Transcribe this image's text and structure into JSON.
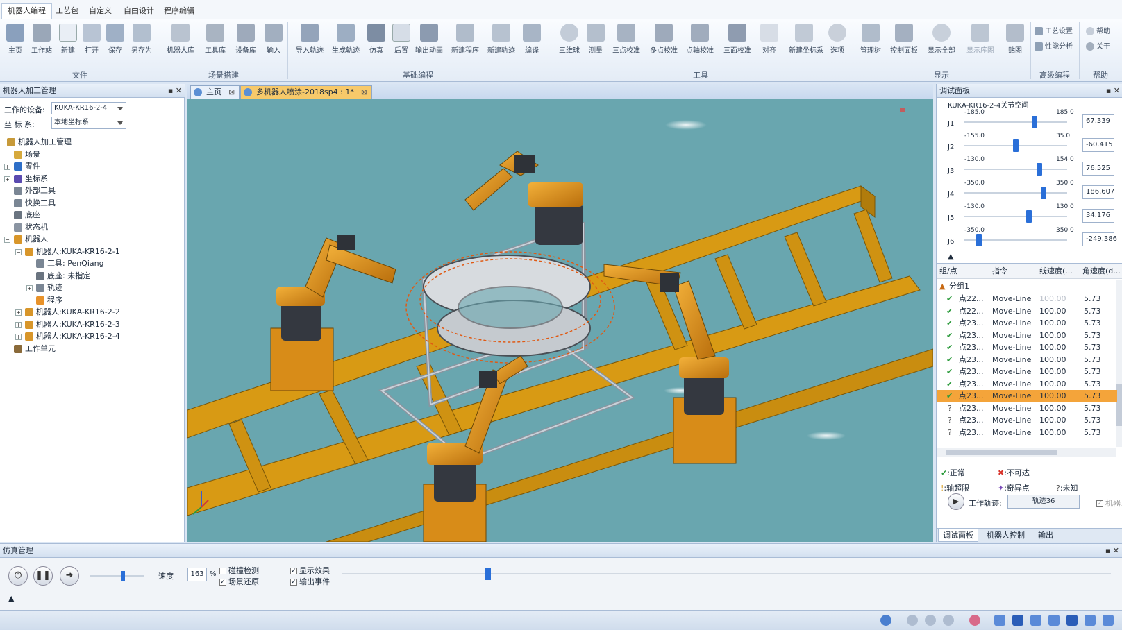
{
  "ribbon": {
    "tabs": [
      {
        "label": "机器人编程"
      },
      {
        "label": "工艺包"
      },
      {
        "label": "自定义"
      },
      {
        "label": "自由设计"
      },
      {
        "label": "程序编辑"
      }
    ],
    "file_buttons": [
      {
        "label": "主页"
      },
      {
        "label": "工作站"
      },
      {
        "label": "新建"
      },
      {
        "label": "打开"
      },
      {
        "label": "保存"
      },
      {
        "label": "另存为"
      }
    ],
    "scene_buttons": [
      {
        "label": "机器人库"
      },
      {
        "label": "工具库"
      },
      {
        "label": "设备库"
      },
      {
        "label": "输入"
      }
    ],
    "basic_buttons": [
      {
        "label": "导入轨迹"
      },
      {
        "label": "生成轨迹"
      },
      {
        "label": "仿真"
      },
      {
        "label": "后置"
      },
      {
        "label": "输出动画"
      },
      {
        "label": "新建程序"
      },
      {
        "label": "新建轨迹"
      },
      {
        "label": "编译"
      }
    ],
    "tool_buttons": [
      {
        "label": "三维球"
      },
      {
        "label": "测量"
      },
      {
        "label": "三点校准"
      },
      {
        "label": "多点校准"
      },
      {
        "label": "点轴校准"
      },
      {
        "label": "三面校准"
      },
      {
        "label": "对齐"
      },
      {
        "label": "新建坐标系"
      },
      {
        "label": "选项"
      }
    ],
    "display_buttons": [
      {
        "label": "管理树"
      },
      {
        "label": "控制面板"
      },
      {
        "label": "显示全部"
      },
      {
        "label": "显示序图"
      },
      {
        "label": "贴图"
      }
    ],
    "advanced": {
      "label1": "工艺设置",
      "label2": "性能分析"
    },
    "help": {
      "label1": "帮助",
      "label2": "关于"
    },
    "groups": {
      "file": "文件",
      "scene": "场景搭建",
      "basic": "基础编程",
      "tools": "工具",
      "display": "显示",
      "advanced": "高级编程",
      "help": "帮助"
    }
  },
  "left_panel": {
    "title": "机器人加工管理",
    "device_label": "工作的设备:",
    "device_value": "KUKA-KR16-2-4",
    "coord_label": "坐  标  系:",
    "coord_value": "本地坐标系",
    "tree": [
      {
        "label": "机器人加工管理"
      },
      {
        "label": "场景"
      },
      {
        "label": "零件"
      },
      {
        "label": "坐标系"
      },
      {
        "label": "外部工具"
      },
      {
        "label": "快换工具"
      },
      {
        "label": "底座"
      },
      {
        "label": "状态机"
      },
      {
        "label": "机器人"
      },
      {
        "label": "机器人:KUKA-KR16-2-1"
      },
      {
        "label": "工具: PenQiang"
      },
      {
        "label": "底座: 未指定"
      },
      {
        "label": "轨迹"
      },
      {
        "label": "程序"
      },
      {
        "label": "机器人:KUKA-KR16-2-2"
      },
      {
        "label": "机器人:KUKA-KR16-2-3"
      },
      {
        "label": "机器人:KUKA-KR16-2-4"
      },
      {
        "label": "工作单元"
      }
    ]
  },
  "doc_tabs": [
    {
      "label": "主页"
    },
    {
      "label": "多机器人喷涂-2018sp4 : 1*"
    }
  ],
  "debug_panel": {
    "title": "调试面板",
    "joint_space_title": "KUKA-KR16-2-4关节空间",
    "joints": [
      {
        "name": "J1",
        "min": "-185.0",
        "max": "185.0",
        "value": "67.339",
        "pos": 0.68
      },
      {
        "name": "J2",
        "min": "-155.0",
        "max": "35.0",
        "value": "-60.415",
        "pos": 0.5
      },
      {
        "name": "J3",
        "min": "-130.0",
        "max": "154.0",
        "value": "76.525",
        "pos": 0.73
      },
      {
        "name": "J4",
        "min": "-350.0",
        "max": "350.0",
        "value": "186.607",
        "pos": 0.77
      },
      {
        "name": "J5",
        "min": "-130.0",
        "max": "130.0",
        "value": "34.176",
        "pos": 0.63
      },
      {
        "name": "J6",
        "min": "-350.0",
        "max": "350.0",
        "value": "-249.386",
        "pos": 0.14
      }
    ],
    "table_headers": {
      "point": "组/点",
      "command": "指令",
      "linear": "线速度(...",
      "angular": "角速度(d..."
    },
    "group_label": "分组1",
    "rows": [
      {
        "status": "ok",
        "name": "点22...",
        "cmd": "Move-Line",
        "lin": "100.00",
        "ang": "5.73",
        "faded": true
      },
      {
        "status": "ok",
        "name": "点22...",
        "cmd": "Move-Line",
        "lin": "100.00",
        "ang": "5.73"
      },
      {
        "status": "ok",
        "name": "点23...",
        "cmd": "Move-Line",
        "lin": "100.00",
        "ang": "5.73"
      },
      {
        "status": "ok",
        "name": "点23...",
        "cmd": "Move-Line",
        "lin": "100.00",
        "ang": "5.73"
      },
      {
        "status": "ok",
        "name": "点23...",
        "cmd": "Move-Line",
        "lin": "100.00",
        "ang": "5.73"
      },
      {
        "status": "ok",
        "name": "点23...",
        "cmd": "Move-Line",
        "lin": "100.00",
        "ang": "5.73"
      },
      {
        "status": "ok",
        "name": "点23...",
        "cmd": "Move-Line",
        "lin": "100.00",
        "ang": "5.73"
      },
      {
        "status": "ok",
        "name": "点23...",
        "cmd": "Move-Line",
        "lin": "100.00",
        "ang": "5.73"
      },
      {
        "status": "ok",
        "name": "点23...",
        "cmd": "Move-Line",
        "lin": "100.00",
        "ang": "5.73",
        "selected": true
      },
      {
        "status": "unknown",
        "name": "点23...",
        "cmd": "Move-Line",
        "lin": "100.00",
        "ang": "5.73"
      },
      {
        "status": "unknown",
        "name": "点23...",
        "cmd": "Move-Line",
        "lin": "100.00",
        "ang": "5.73"
      },
      {
        "status": "unknown",
        "name": "点23...",
        "cmd": "Move-Line",
        "lin": "100.00",
        "ang": "5.73"
      }
    ],
    "legend": {
      "normal": ":正常",
      "unreachable": ":不可达",
      "axis_limit": ":轴超限",
      "singular": ":奇异点",
      "unknown": ":未知"
    },
    "work_track_label": "工作轨迹:",
    "work_track_value": "轨迹36",
    "robot_check": "机器人",
    "bottom_tabs": [
      {
        "label": "调试面板"
      },
      {
        "label": "机器人控制"
      },
      {
        "label": "输出"
      }
    ]
  },
  "sim_panel": {
    "title": "仿真管理",
    "speed_label": "速度",
    "speed_value": "163",
    "percent": "%",
    "speed_level": 0.6,
    "timeline_level": 0.19,
    "checks": [
      {
        "label": "碰撞检测",
        "checked": false
      },
      {
        "label": "场景还原",
        "checked": true
      },
      {
        "label": "显示效果",
        "checked": true
      },
      {
        "label": "输出事件",
        "checked": true
      }
    ]
  },
  "colors": {
    "robot_orange": "#e0961e",
    "track_yellow": "#d89a14",
    "floor_teal": "#69a6af",
    "selected_row": "#f4a43a",
    "slider_blue": "#2a6fd8"
  }
}
